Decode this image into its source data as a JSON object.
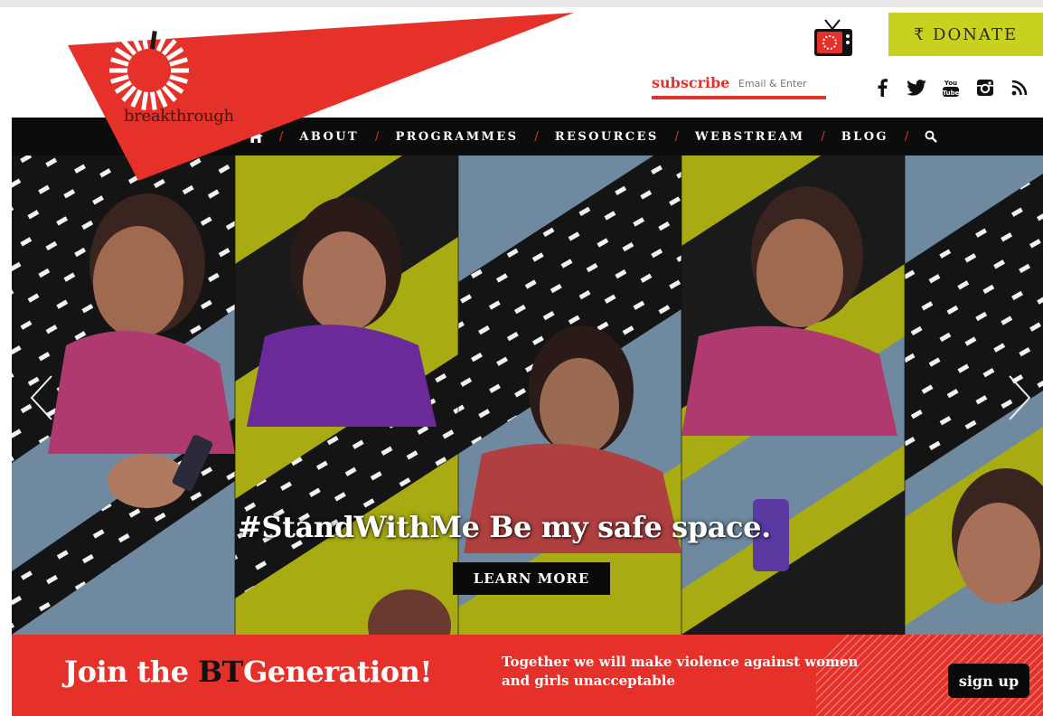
{
  "header": {
    "logo_text": "breakthrough",
    "donate_label": "₹ DONATE",
    "subscribe_label": "subscribe",
    "subscribe_placeholder": "Email & Enter",
    "socials": [
      "facebook-icon",
      "twitter-icon",
      "youtube-icon",
      "instagram-icon",
      "rss-icon"
    ]
  },
  "nav": {
    "items": [
      "ABOUT",
      "PROGRAMMES",
      "RESOURCES",
      "WEBSTREAM",
      "BLOG"
    ],
    "separator": "/"
  },
  "hero": {
    "headline": "#StandWithMe Be my safe space.",
    "cta_label": "LEARN MORE"
  },
  "band": {
    "join_prefix": "Join the ",
    "join_bt": "BT",
    "join_suffix": "Generation!",
    "tagline": "Together we will make violence against women and girls unacceptable",
    "signup_label": "sign up"
  },
  "colors": {
    "brand_red": "#e5312a",
    "donate_yellow": "#c8d11f",
    "olive": "#a9ab12",
    "slate_blue": "#6f8aa0",
    "nav_black": "#0c0c0c"
  }
}
